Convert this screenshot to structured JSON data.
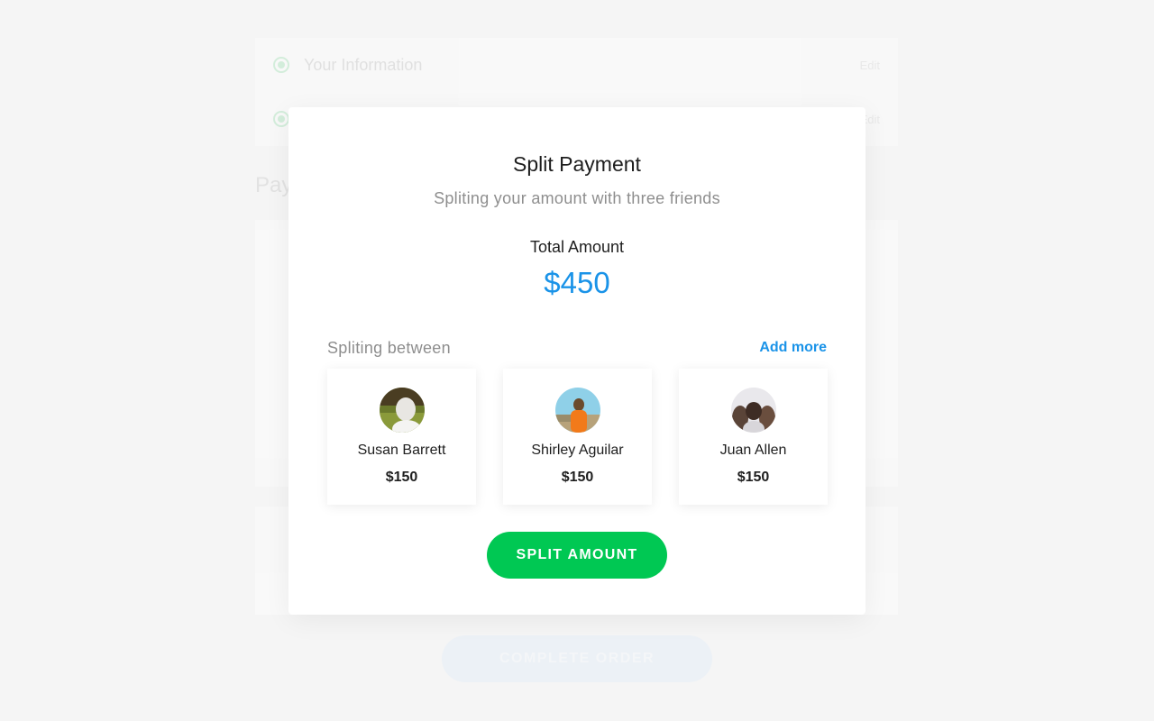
{
  "background": {
    "sections": [
      {
        "title": "Your Information",
        "edit_label": "Edit"
      },
      {
        "title": "",
        "edit_label": "Edit"
      }
    ],
    "payment_heading": "Pay",
    "complete_order_label": "COMPLETE ORDER"
  },
  "modal": {
    "title": "Split Payment",
    "subtitle": "Spliting your amount with three friends",
    "total_label": "Total Amount",
    "total_amount": "$450",
    "split_label": "Spliting between",
    "add_more_label": "Add more",
    "friends": [
      {
        "name": "Susan Barrett",
        "amount": "$150",
        "avatar_icon": "person-photo-avatar"
      },
      {
        "name": "Shirley Aguilar",
        "amount": "$150",
        "avatar_icon": "person-photo-avatar"
      },
      {
        "name": "Juan Allen",
        "amount": "$150",
        "avatar_icon": "person-photo-avatar"
      }
    ],
    "split_button_label": "SPLIT AMOUNT"
  },
  "colors": {
    "accent_blue": "#1a93e8",
    "primary_green": "#00c853",
    "text_dark": "#1e1e1e",
    "text_muted": "#8e8e8e"
  }
}
